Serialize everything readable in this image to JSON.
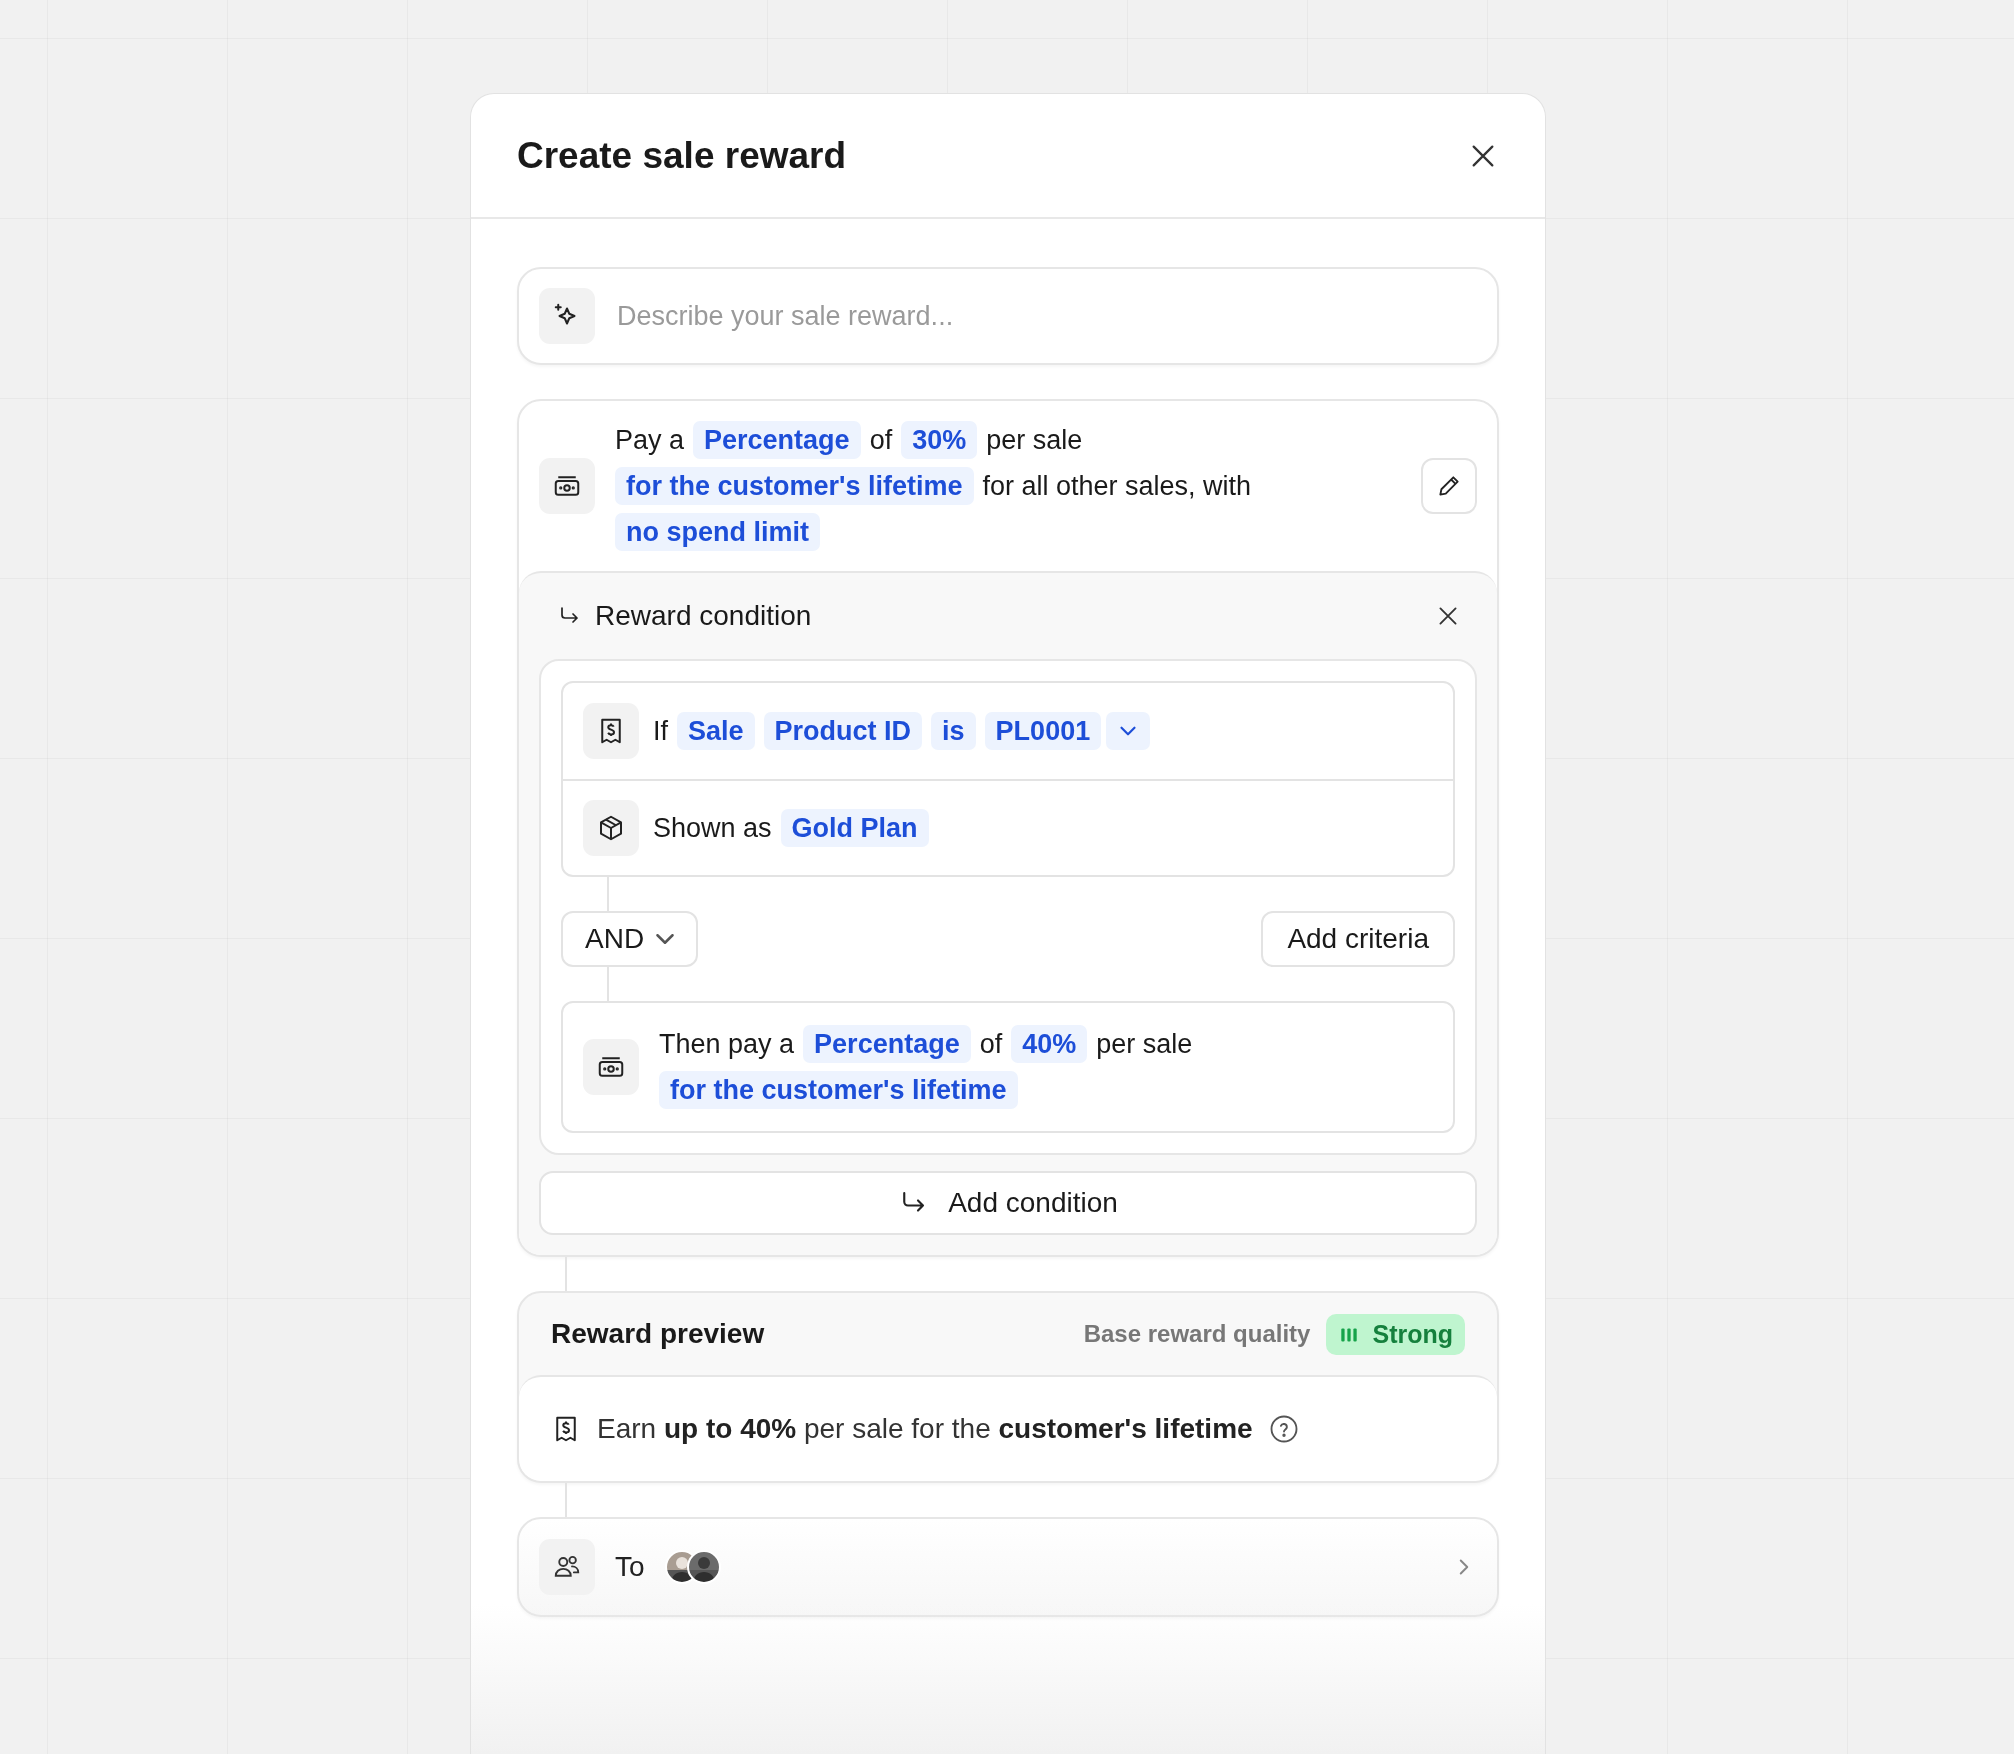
{
  "modal": {
    "title": "Create sale reward"
  },
  "prompt": {
    "placeholder": "Describe your sale reward..."
  },
  "reward": {
    "lines": [
      [
        {
          "kind": "text",
          "text": "Pay a"
        },
        {
          "kind": "token",
          "text": "Percentage"
        },
        {
          "kind": "text",
          "text": "of"
        },
        {
          "kind": "token",
          "text": "30%"
        },
        {
          "kind": "text",
          "text": "per sale"
        }
      ],
      [
        {
          "kind": "token",
          "text": "for the customer's lifetime"
        },
        {
          "kind": "text",
          "text": "for all other sales, with"
        }
      ],
      [
        {
          "kind": "token",
          "text": "no spend limit"
        }
      ]
    ]
  },
  "condition": {
    "title": "Reward condition",
    "criteria": [
      {
        "kind": "filter",
        "parts": [
          {
            "kind": "text",
            "text": "If"
          },
          {
            "kind": "token",
            "text": "Sale"
          },
          {
            "kind": "token",
            "text": "Product ID"
          },
          {
            "kind": "token",
            "text": "is"
          },
          {
            "kind": "token",
            "text": "PL0001"
          },
          {
            "kind": "menu"
          }
        ]
      },
      {
        "kind": "display",
        "parts": [
          {
            "kind": "text",
            "text": "Shown as"
          },
          {
            "kind": "token",
            "text": "Gold Plan"
          }
        ]
      }
    ],
    "operator": "AND",
    "add_criteria": "Add criteria",
    "result": {
      "lines": [
        [
          {
            "kind": "text",
            "text": "Then pay a"
          },
          {
            "kind": "token",
            "text": "Percentage"
          },
          {
            "kind": "text",
            "text": "of"
          },
          {
            "kind": "token",
            "text": "40%"
          },
          {
            "kind": "text",
            "text": "per sale"
          }
        ],
        [
          {
            "kind": "token",
            "text": "for the customer's lifetime"
          }
        ]
      ]
    },
    "add_condition": "Add condition"
  },
  "preview": {
    "title": "Reward preview",
    "quality_label": "Base reward quality",
    "quality": "Strong",
    "summary": "Earn **up to 40%** per sale for the **customer's lifetime**"
  },
  "audience": {
    "label": "To"
  }
}
